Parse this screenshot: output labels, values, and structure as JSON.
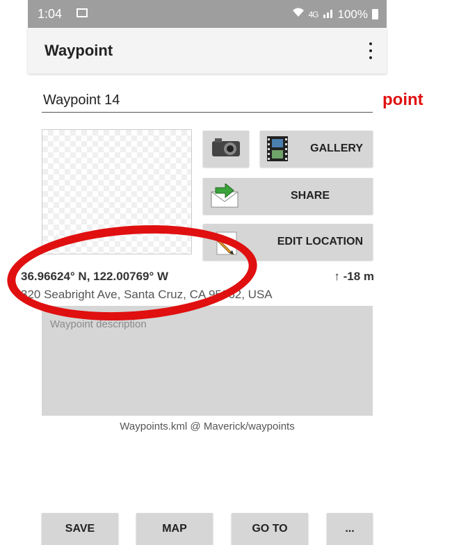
{
  "status_bar": {
    "time": "1:04",
    "signal": "4G",
    "battery": "100%"
  },
  "app_bar": {
    "title": "Waypoint"
  },
  "waypoint": {
    "name": "Waypoint 14",
    "coordinates": "36.96624° N, 122.00769° W",
    "elevation": "↑ -18 m",
    "address": "320 Seabright Ave, Santa Cruz, CA 95062, USA",
    "description_placeholder": "Waypoint description",
    "file_info": "Waypoints.kml @ Maverick/waypoints"
  },
  "actions": {
    "gallery_label": "GALLERY",
    "share_label": "SHARE",
    "edit_location_label": "EDIT LOCATION"
  },
  "bottom_bar": {
    "save_label": "SAVE",
    "map_label": "MAP",
    "goto_label": "GO TO",
    "more_label": "..."
  },
  "overlay": {
    "fragment_text": "point",
    "annotation_color": "#e01010"
  },
  "colors": {
    "status_bar": "#9e9e9e",
    "button_bg": "#d6d6d6"
  },
  "icons": [
    "image-icon",
    "wifi-icon",
    "battery-icon",
    "more-vert-icon",
    "camera-icon",
    "gallery-film-icon",
    "share-envelope-icon",
    "edit-pencil-icon"
  ]
}
